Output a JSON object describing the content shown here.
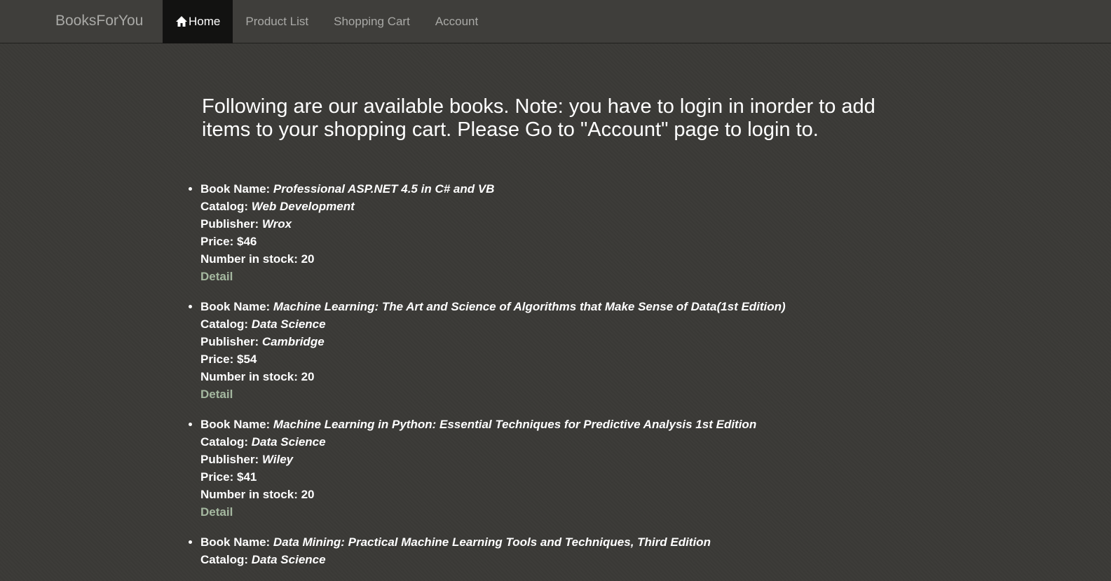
{
  "nav": {
    "brand": "BooksForYou",
    "items": [
      {
        "label": "Home",
        "icon": "home-icon",
        "active": true
      },
      {
        "label": "Product List"
      },
      {
        "label": "Shopping Cart"
      },
      {
        "label": "Account"
      }
    ]
  },
  "intro": "Following are our available books. Note: you have to login in inorder to add items to your shopping cart. Please Go to \"Account\" page to login to.",
  "labels": {
    "book_name": "Book Name:",
    "catalog": "Catalog:",
    "publisher": "Publisher:",
    "price": "Price:",
    "stock": "Number in stock:",
    "detail": "Detail"
  },
  "books": [
    {
      "name": "Professional ASP.NET 4.5 in C# and VB",
      "catalog": "Web Development",
      "publisher": "Wrox",
      "price": "$46",
      "stock": "20"
    },
    {
      "name": "Machine Learning: The Art and Science of Algorithms that Make Sense of Data(1st Edition)",
      "catalog": "Data Science",
      "publisher": "Cambridge",
      "price": "$54",
      "stock": "20"
    },
    {
      "name": "Machine Learning in Python: Essential Techniques for Predictive Analysis 1st Edition",
      "catalog": "Data Science",
      "publisher": "Wiley",
      "price": "$41",
      "stock": "20"
    },
    {
      "name": "Data Mining: Practical Machine Learning Tools and Techniques, Third Edition",
      "catalog": "Data Science"
    }
  ],
  "colors": {
    "background": "#3b3a37",
    "navbar": "#3f3e3b",
    "active_tab": "#121211",
    "link": "#a5b8a0",
    "nav_text": "#a9a9a6"
  }
}
